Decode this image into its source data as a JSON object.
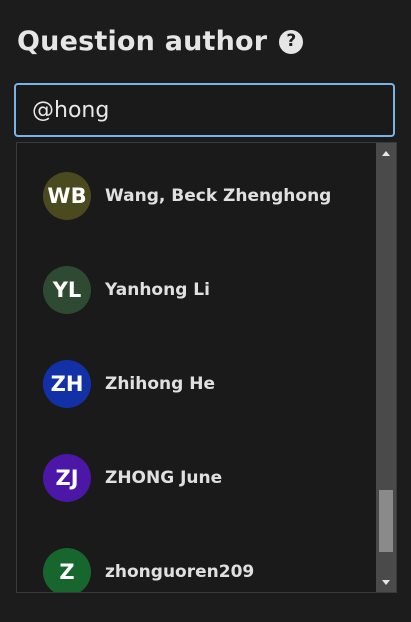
{
  "header": {
    "title": "Question author",
    "help_icon": "question-circle-icon"
  },
  "search": {
    "value": "@hong"
  },
  "results": [
    {
      "initials": "WB",
      "name": "Wang, Beck Zhenghong",
      "color": "#4a4a1e"
    },
    {
      "initials": "YL",
      "name": "Yanhong Li",
      "color": "#2f4a33"
    },
    {
      "initials": "ZH",
      "name": "Zhihong He",
      "color": "#1231a6"
    },
    {
      "initials": "ZJ",
      "name": "ZHONG June",
      "color": "#4c17a6"
    },
    {
      "initials": "Z",
      "name": "zhonguoren209",
      "color": "#17662e"
    }
  ],
  "scrollbar": {
    "position": 0.85
  }
}
